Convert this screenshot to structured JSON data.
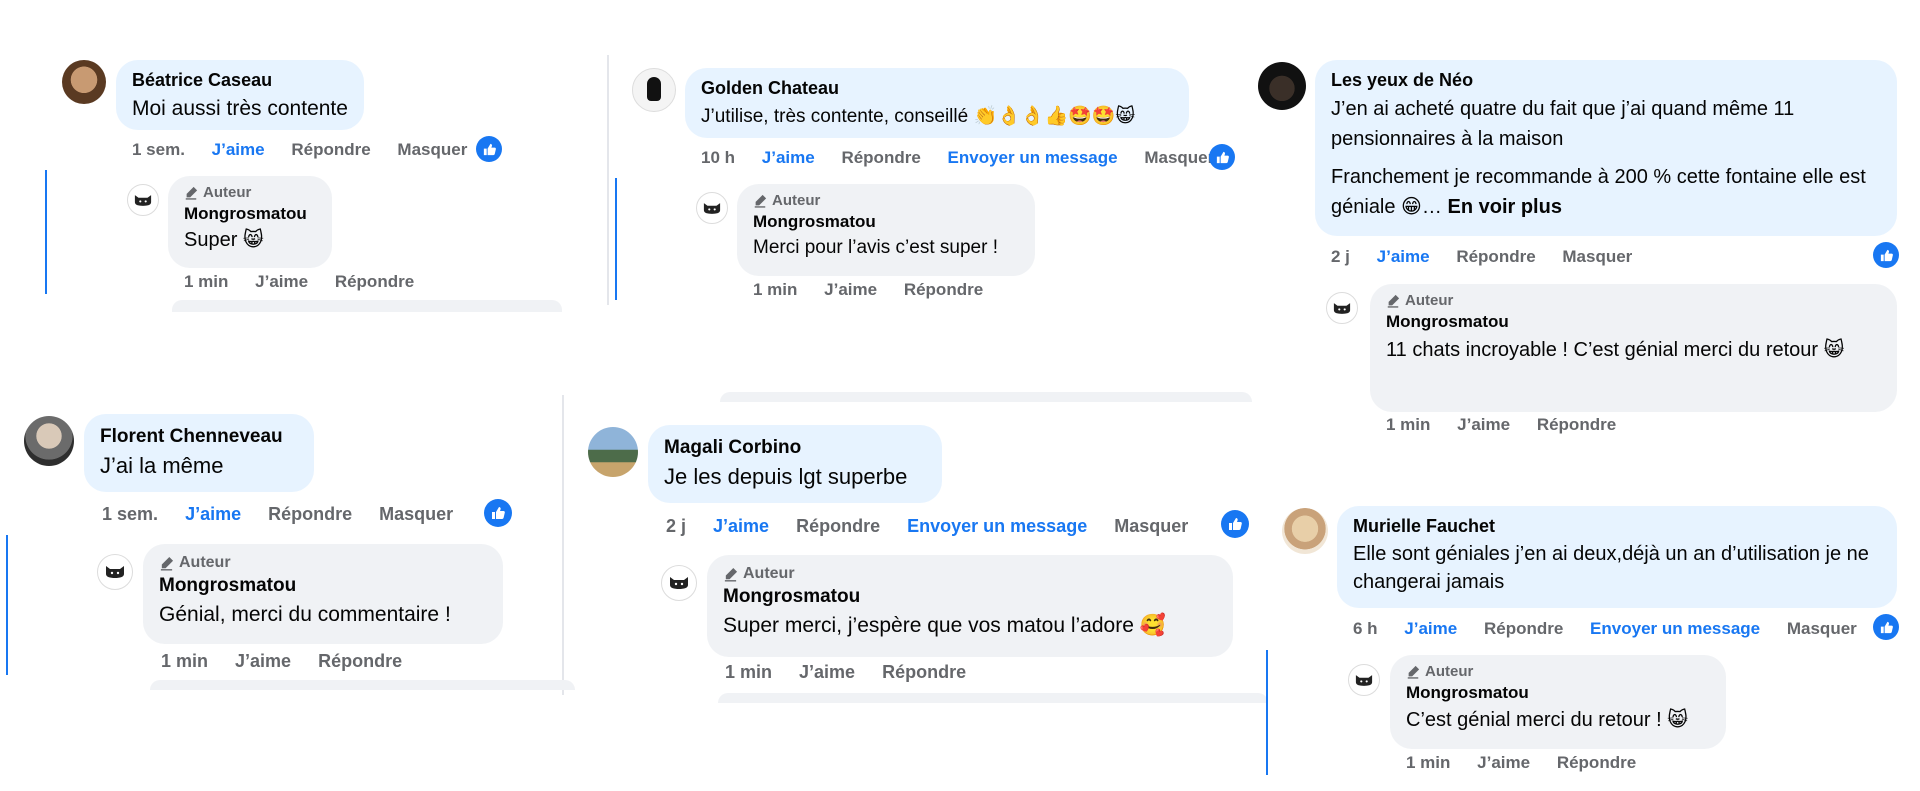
{
  "labels": {
    "like": "J’aime",
    "reply": "Répondre",
    "hide": "Masquer",
    "message": "Envoyer un message",
    "author": "Auteur",
    "see_more": "En voir plus"
  },
  "colors": {
    "accent": "#1877f2",
    "comment_bg": "#e7f3ff",
    "reply_bg": "#f0f2f5",
    "meta": "#65676b"
  },
  "threads": [
    {
      "name": "Béatrice Caseau",
      "text": "Moi aussi très contente",
      "time": "1 sem.",
      "reply": {
        "name": "Mongrosmatou",
        "text": "Super 😸",
        "time": "1 min"
      }
    },
    {
      "name": "Golden Chateau",
      "text": "J’utilise, très contente, conseillé 👏👌👌👍🤩🤩😸",
      "time": "10 h",
      "reply": {
        "name": "Mongrosmatou",
        "text": "Merci pour l’avis c’est super !",
        "time": "1 min"
      }
    },
    {
      "name": "Les yeux de Néo",
      "text": "J’en ai acheté quatre du fait que j’ai quand même 11 pensionnaires à la maison",
      "text2": "Franchement je recommande à 200 % cette fontaine elle est géniale 😁…",
      "time": "2 j",
      "reply": {
        "name": "Mongrosmatou",
        "text": "11 chats incroyable ! C’est génial merci du retour 😸",
        "time": "1 min"
      }
    },
    {
      "name": "Florent Chenneveau",
      "text": "J’ai la même",
      "time": "1 sem.",
      "reply": {
        "name": "Mongrosmatou",
        "text": "Génial, merci du commentaire !",
        "time": "1 min"
      }
    },
    {
      "name": "Magali Corbino",
      "text": "Je les depuis lgt superbe",
      "time": "2 j",
      "reply": {
        "name": "Mongrosmatou",
        "text": "Super merci, j’espère que vos matou l’adore 🥰",
        "time": "1 min"
      }
    },
    {
      "name": "Murielle Fauchet",
      "text": "Elle sont géniales j’en ai deux,déjà un an d’utilisation je ne changerai jamais",
      "time": "6 h",
      "reply": {
        "name": "Mongrosmatou",
        "text": "C’est génial merci du retour ! 😸",
        "time": "1 min"
      }
    }
  ]
}
